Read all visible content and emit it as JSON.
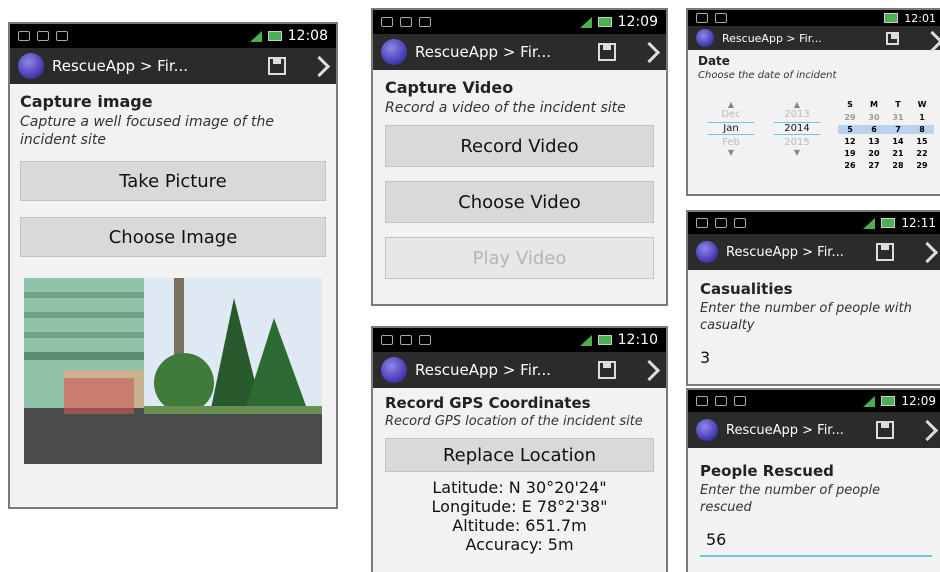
{
  "status": {
    "times": [
      "12:08",
      "12:09",
      "12:01",
      "12:11",
      "12:10",
      "12:09"
    ]
  },
  "app": {
    "title": "RescueApp > Fir..."
  },
  "image_screen": {
    "heading": "Capture image",
    "subtitle": "Capture a well focused image of the incident site",
    "buttons": {
      "take": "Take Picture",
      "choose": "Choose Image"
    }
  },
  "video_screen": {
    "heading": "Capture Video",
    "subtitle": "Record a video of the incident site",
    "buttons": {
      "record": "Record Video",
      "choose": "Choose Video",
      "play": "Play Video"
    }
  },
  "gps_screen": {
    "heading": "Record GPS Coordinates",
    "subtitle": "Record GPS location of the incident site",
    "buttons": {
      "replace": "Replace Location"
    },
    "coords": {
      "latitude": "Latitude: N 30°20'24\"",
      "longitude": "Longitude: E 78°2'38\"",
      "altitude": "Altitude: 651.7m",
      "accuracy": "Accuracy: 5m"
    }
  },
  "date_screen": {
    "heading": "Date",
    "subtitle": "Choose the date of incident",
    "picker": {
      "months": [
        "Dec",
        "Jan",
        "Feb"
      ],
      "years": [
        "2013",
        "2014",
        "2015"
      ]
    },
    "calendar": {
      "weekdays": [
        "S",
        "M",
        "T",
        "W"
      ],
      "rows": [
        [
          "29",
          "30",
          "31",
          "1"
        ],
        [
          "5",
          "6",
          "7",
          "8"
        ],
        [
          "12",
          "13",
          "14",
          "15"
        ],
        [
          "19",
          "20",
          "21",
          "22"
        ],
        [
          "26",
          "27",
          "28",
          "29"
        ]
      ]
    }
  },
  "casualties_screen": {
    "heading": "Casualities",
    "subtitle": "Enter the number of people with casualty",
    "value": "3"
  },
  "rescued_screen": {
    "heading": "People Rescued",
    "subtitle": "Enter the number of people rescued",
    "value": "56"
  },
  "colors": {
    "statusbar": "#000000",
    "appbar": "#2b2b2b",
    "button": "#d9d9d9",
    "accent": "#6dc3e8",
    "calendar_select": "#b9d3ee"
  }
}
